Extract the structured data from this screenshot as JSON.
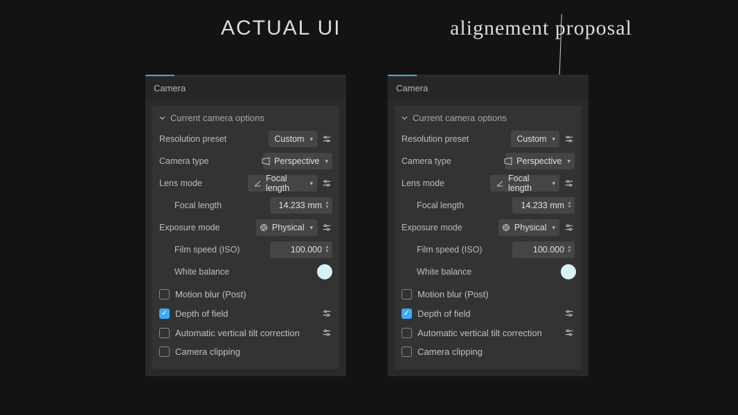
{
  "titles": {
    "left": "ACTUAL UI",
    "right": "alignement proposal"
  },
  "panel": {
    "title": "Camera",
    "section_header": "Current camera options",
    "rows": {
      "resolution_preset": {
        "label": "Resolution preset",
        "value": "Custom"
      },
      "camera_type": {
        "label": "Camera type",
        "value": "Perspective"
      },
      "lens_mode": {
        "label": "Lens mode",
        "value": "Focal length"
      },
      "focal_length": {
        "label": "Focal length",
        "value": "14.233 mm"
      },
      "exposure_mode": {
        "label": "Exposure mode",
        "value": "Physical"
      },
      "film_speed": {
        "label": "Film speed (ISO)",
        "value": "100.000"
      },
      "white_balance": {
        "label": "White balance",
        "color": "#d6f3fb"
      }
    },
    "checks": {
      "motion_blur": {
        "label": "Motion blur (Post)",
        "checked": false
      },
      "depth_of_field": {
        "label": "Depth of field",
        "checked": true
      },
      "auto_tilt": {
        "label": "Automatic vertical tilt correction",
        "checked": false
      },
      "camera_clipping": {
        "label": "Camera clipping",
        "checked": false
      }
    }
  }
}
